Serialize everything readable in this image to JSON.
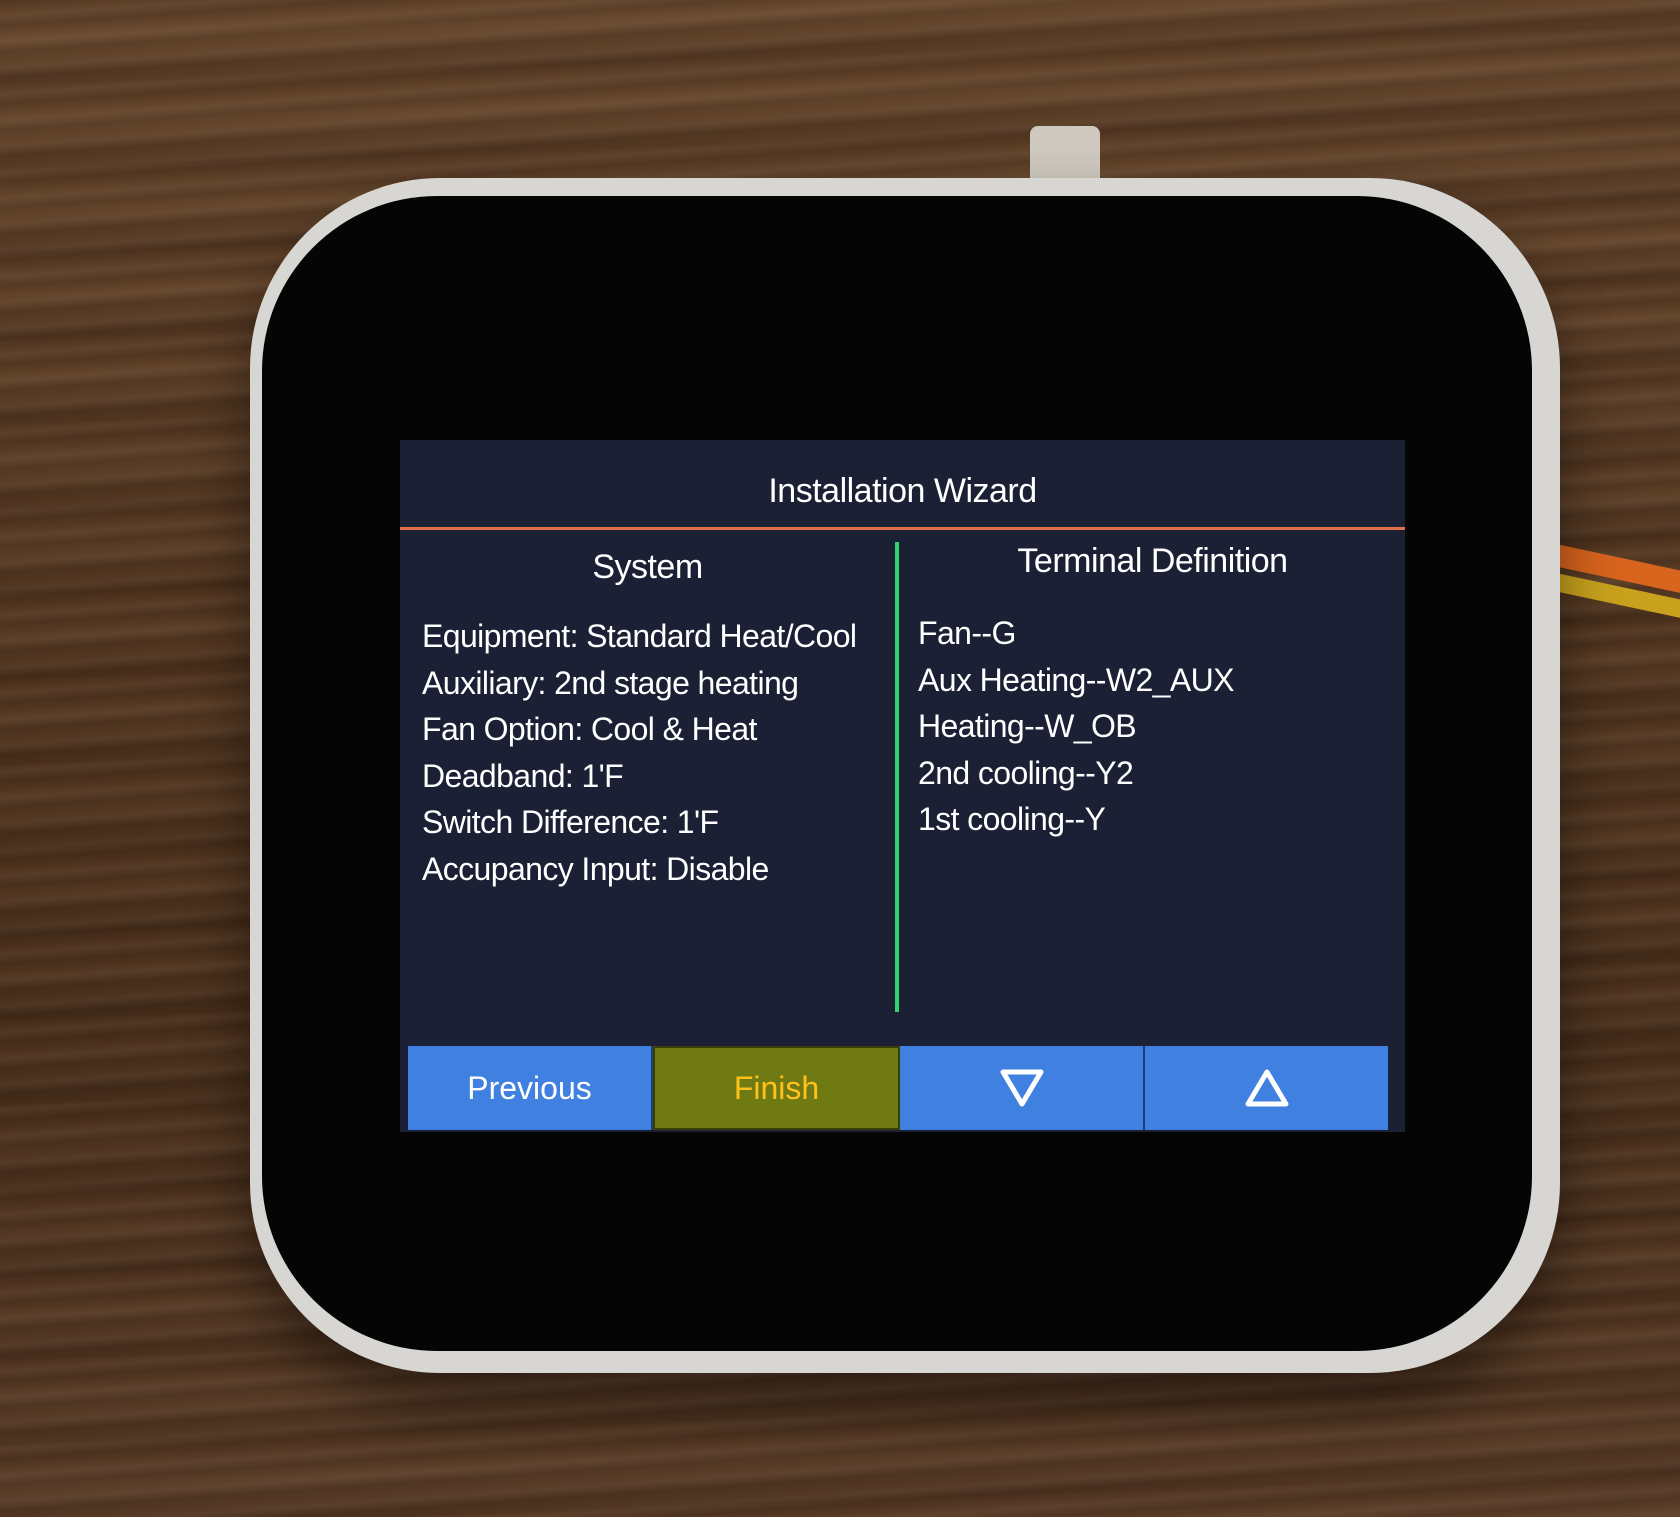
{
  "screen": {
    "title": "Installation Wizard",
    "system": {
      "header": "System",
      "items": [
        "Equipment: Standard Heat/Cool",
        "Auxiliary: 2nd stage heating",
        "Fan Option: Cool & Heat",
        "Deadband: 1'F",
        "Switch Difference: 1'F",
        "Accupancy Input: Disable"
      ]
    },
    "terminal": {
      "header": "Terminal Definition",
      "items": [
        "Fan--G",
        "Aux Heating--W2_AUX",
        "Heating--W_OB",
        "2nd cooling--Y2",
        "1st cooling--Y"
      ]
    },
    "buttons": {
      "previous": "Previous",
      "finish": "Finish",
      "down_icon": "triangle-down-icon",
      "up_icon": "triangle-up-icon"
    }
  },
  "colors": {
    "screen_bg": "#1b2034",
    "title_rule": "#e0704a",
    "divider": "#2fd46a",
    "button_blue": "#3f80e0",
    "finish_bg": "#6f7a12",
    "finish_text": "#ffc21a"
  }
}
